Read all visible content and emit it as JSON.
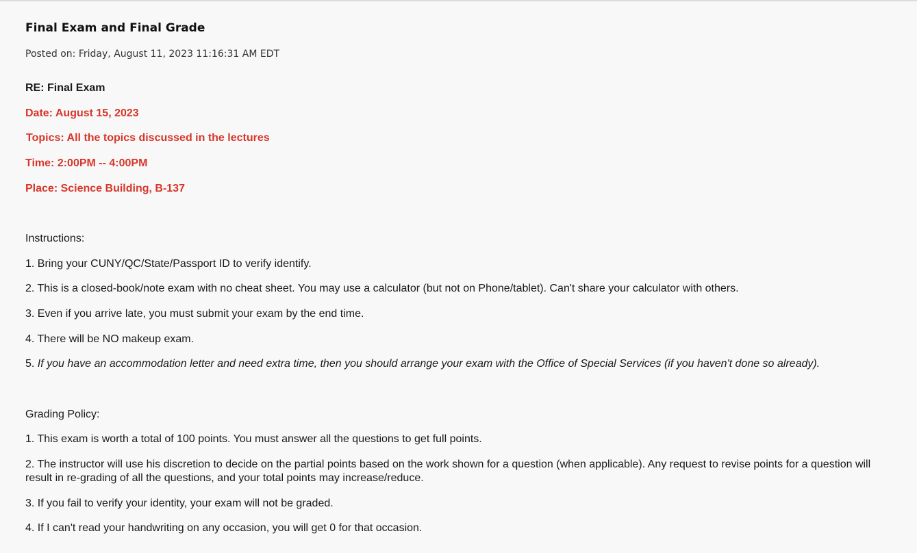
{
  "post": {
    "title": "Final Exam and Final Grade",
    "posted_label": "Posted on: ",
    "posted_date": "Friday, August 11, 2023 11:16:31 AM EDT"
  },
  "details": {
    "re": "RE: Final Exam",
    "date": "Date:  August 15, 2023",
    "topics": "Topics: All the topics discussed in the lectures",
    "time": "Time: 2:00PM -- 4:00PM",
    "place": "Place: Science Building, B-137"
  },
  "instructions": {
    "heading": "Instructions:",
    "item1": "1. Bring your CUNY/QC/State/Passport ID to verify identify.",
    "item2": "2. This is a closed-book/note exam with no cheat sheet. You may use a calculator (but not on Phone/tablet). Can't share your calculator with others.",
    "item3": "3. Even if you arrive late, you must submit your exam by the end time.",
    "item4": "4. There will be NO makeup exam.",
    "item5_number": "5. ",
    "item5_text": "If you have an accommodation letter and need extra time, then you should arrange your exam with the Office of Special Services (if you haven't done so already)."
  },
  "grading": {
    "heading": "Grading Policy:",
    "item1": "1. This exam is worth a total of 100 points. You must answer all the questions to get full points.",
    "item2": "2. The instructor will use his discretion to decide on the partial points based on the work shown for a question (when applicable). Any request to revise points for a question will result in re-grading of all the questions, and your total points may increase/reduce.",
    "item3": "3. If you fail to verify your identity, your exam will not be graded.",
    "item4": "4. If I can't read your handwriting on any occasion, you will get 0 for that occasion."
  }
}
